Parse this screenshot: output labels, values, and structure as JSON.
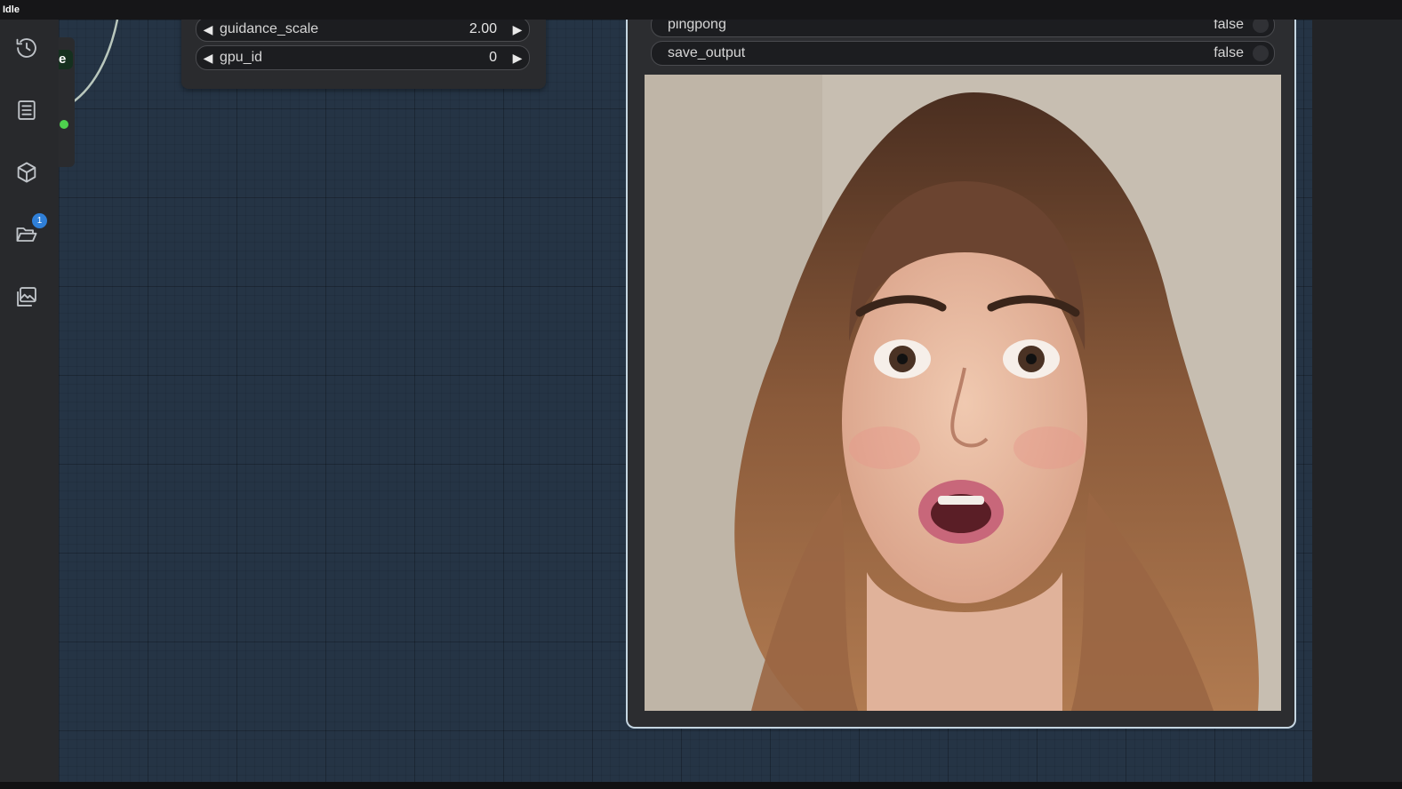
{
  "status": {
    "text": "Idle"
  },
  "sidebar": {
    "items": [
      {
        "icon": "history-icon"
      },
      {
        "icon": "list-icon"
      },
      {
        "icon": "cube-icon"
      },
      {
        "icon": "folder-icon",
        "badge": "1"
      },
      {
        "icon": "images-icon"
      }
    ]
  },
  "left_node": {
    "label": "e"
  },
  "params": [
    {
      "label": "guidance_scale",
      "value": "2.00"
    },
    {
      "label": "gpu_id",
      "value": "0"
    }
  ],
  "output_node": {
    "toggles": [
      {
        "label": "pingpong",
        "value": "false"
      },
      {
        "label": "save_output",
        "value": "false"
      }
    ],
    "preview": {
      "alt": "Woman with long wavy brown hair and a surprised expression"
    }
  },
  "colors": {
    "canvas": "#253445",
    "node": "#2a2b2e",
    "selected_outline": "#c5d6e2",
    "link_dot": "#4ed24e",
    "badge": "#2f7fd8"
  }
}
